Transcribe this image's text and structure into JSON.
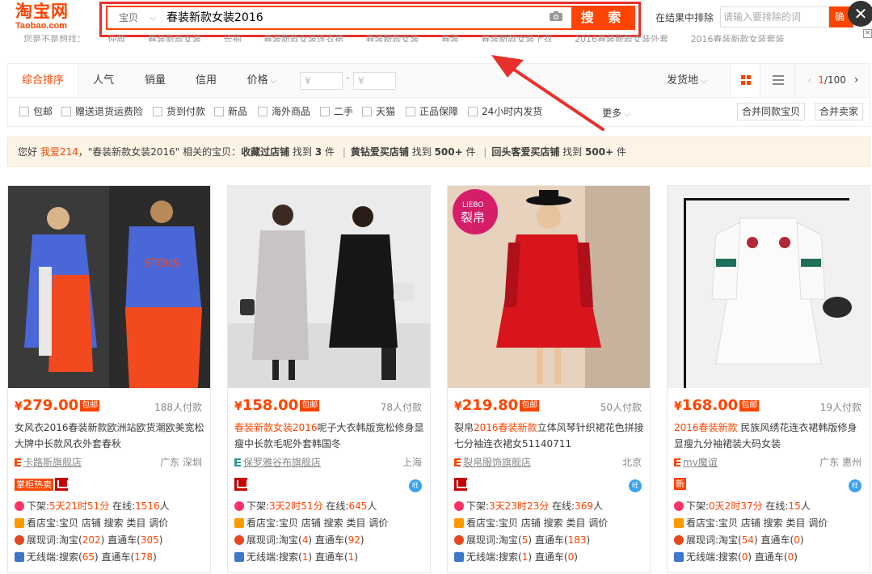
{
  "header": {
    "logo_cn": "淘宝网",
    "logo_en": "Taobao.com",
    "search_category": "宝贝",
    "search_query": "春装新款女装2016",
    "search_button": "搜 索",
    "exclude_label": "在结果中排除",
    "exclude_placeholder": "请输入要排除的词",
    "exclude_button": "确",
    "accent_color": "#ff4400",
    "highlight_border_color": "#e8312c"
  },
  "suggestions": [
    "您是不是想找：",
    "仲款",
    "春装新款女装",
    "长袖",
    "春装新款女装连衣裙",
    "春装新款女装",
    "春装",
    "春装新款女装上衣",
    "2016春装新款女装外套",
    "2016春装新款女装套装"
  ],
  "sort_bar": {
    "tabs": [
      "综合排序",
      "人气",
      "销量",
      "信用",
      "价格"
    ],
    "active_tab": "综合排序",
    "price_min_placeholder": "¥",
    "price_max_placeholder": "¥",
    "price_dash": "-",
    "ship_from": "发货地",
    "page_current": "1",
    "page_total": "/100"
  },
  "filters": {
    "checkboxes": [
      "包邮",
      "赠送退货运费险",
      "货到付款",
      "新品",
      "海外商品",
      "二手",
      "天猫",
      "正品保障",
      "24小时内发货"
    ],
    "more": "更多",
    "merge_same": "合并同款宝贝",
    "merge_seller": "合并卖家"
  },
  "notice": {
    "greet": "您好 ",
    "user": "我爱214",
    "mid": "，\"春装新款女装2016\" 相关的宝贝：",
    "s1_label": "收藏过店铺",
    "s1_pre": " 找到 ",
    "s1_count": "3",
    "s1_suf": " 件",
    "sep": "|",
    "s2_label": "黄钻爱买店铺",
    "s2_pre": " 找到 ",
    "s2_count": "500+",
    "s2_suf": " 件",
    "s3_label": "回头客爱买店铺",
    "s3_pre": " 找到 ",
    "s3_count": "500+",
    "s3_suf": " 件"
  },
  "products": [
    {
      "price": "279.00",
      "badge": "包邮",
      "paid": "188人付款",
      "title_pre": "女风衣2016春装新款欧洲站欧货潮欧美宽松大牌中长款风衣外套春秋",
      "title_hl": "",
      "title_post": "",
      "shop": "卡路斯旗舰店",
      "location": "广东 深圳",
      "tag": "掌柜热卖",
      "shelf_pre": "下架:",
      "shelf_time": "5天21时51分",
      "online_pre": " 在线:",
      "online": "1516",
      "online_suf": "人",
      "store_line": "看店宝:宝贝 店铺 搜索 类目 调价",
      "show_pre": "展现词:淘宝(",
      "show_n": "202",
      "show_mid": ") 直通车(",
      "show_m": "305",
      "show_suf": ")",
      "mob_pre": "无线端:搜索(",
      "mob_n": "65",
      "mob_mid": ") 直通车(",
      "mob_m": "178",
      "mob_suf": ")"
    },
    {
      "price": "158.00",
      "badge": "包邮",
      "paid": "78人付款",
      "title_pre": "",
      "title_hl": "春装新款女装2016",
      "title_post": "呢子大衣韩版宽松修身显瘦中长款毛呢外套韩国冬",
      "shop": "保罗雅谷布旗舰店",
      "location": "上海",
      "tag": "",
      "shelf_pre": "下架:",
      "shelf_time": "3天2时51分",
      "online_pre": " 在线:",
      "online": "645",
      "online_suf": "人",
      "store_line": "看店宝:宝贝 店铺 搜索 类目 调价",
      "show_pre": "展现词:淘宝(",
      "show_n": "4",
      "show_mid": ") 直通车(",
      "show_m": "92",
      "show_suf": ")",
      "mob_pre": "无线端:搜索(",
      "mob_n": "1",
      "mob_mid": ") 直通车(",
      "mob_m": "1",
      "mob_suf": ")"
    },
    {
      "price": "219.80",
      "badge": "包邮",
      "paid": "50人付款",
      "title_pre": "裂帛",
      "title_hl": "2016春装新款",
      "title_post": "立体风琴针织裙花色拼接七分袖连衣裙女51140711",
      "shop": "裂帛服饰旗舰店",
      "location": "北京",
      "tag": "",
      "shelf_pre": "下架:",
      "shelf_time": "3天23时23分",
      "online_pre": " 在线:",
      "online": "369",
      "online_suf": "人",
      "store_line": "看店宝:宝贝 店铺 搜索 类目 调价",
      "show_pre": "展现词:淘宝(",
      "show_n": "5",
      "show_mid": ") 直通车(",
      "show_m": "183",
      "show_suf": ")",
      "mob_pre": "无线端:搜索(",
      "mob_n": "1",
      "mob_mid": ") 直通车(",
      "mob_m": "0",
      "mob_suf": ")"
    },
    {
      "price": "168.00",
      "badge": "包邮",
      "paid": "19人付款",
      "title_pre": "",
      "title_hl": "2016春装新款",
      "title_post": " 民族风绣花连衣裙韩版修身显瘦九分袖裙装大码女装",
      "shop": "mv魔谊",
      "location": "广东 惠州",
      "tag": "新",
      "shelf_pre": "下架:",
      "shelf_time": "0天2时37分",
      "online_pre": " 在线:",
      "online": "15",
      "online_suf": "人",
      "store_line": "看店宝:宝贝 店铺 搜索 类目 调价",
      "show_pre": "展现词:淘宝(",
      "show_n": "54",
      "show_mid": ") 直通车(",
      "show_m": "0",
      "show_suf": ")",
      "mob_pre": "无线端:搜索(",
      "mob_n": "0",
      "mob_mid": ") 直通车(",
      "mob_m": "0",
      "mob_suf": ")"
    }
  ],
  "image_overlay_brand": {
    "en": "LIEBO",
    "cn": "裂帛"
  },
  "image_text_back": "STOUS"
}
